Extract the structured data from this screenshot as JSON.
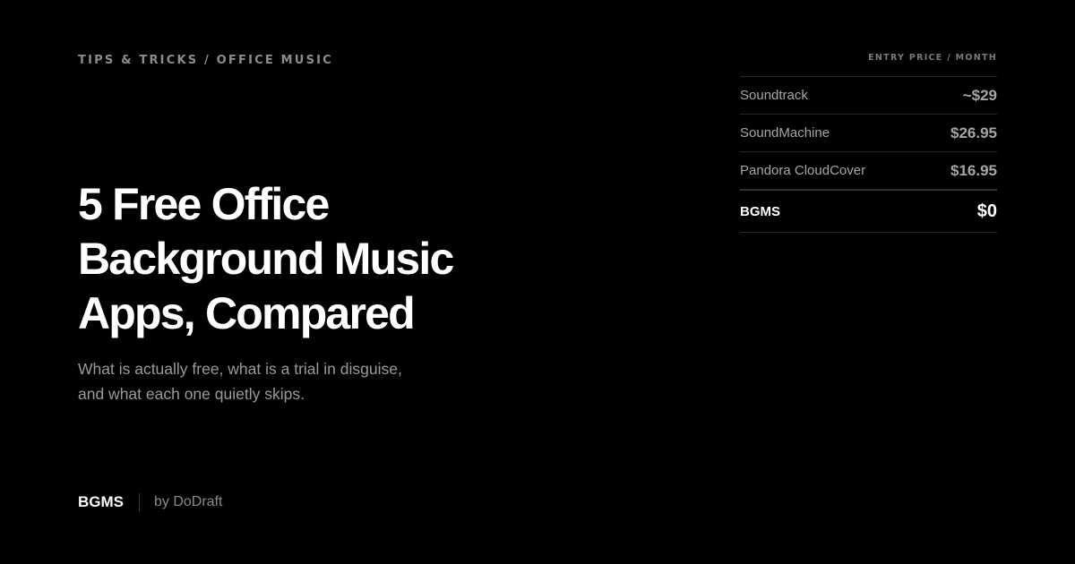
{
  "breadcrumb": "TIPS & TRICKS / OFFICE MUSIC",
  "title": {
    "line1": "5 Free Office",
    "line2": "Background Music",
    "line3": "Apps, Compared"
  },
  "subtitle": {
    "line1": "What is actually free, what is a trial in disguise,",
    "line2": "and what each one quietly skips."
  },
  "footer": {
    "brand": "BGMS",
    "byline": "by DoDraft"
  },
  "price_table": {
    "header": "ENTRY PRICE / MONTH",
    "rows": [
      {
        "name": "Soundtrack",
        "price": "~$29"
      },
      {
        "name": "SoundMachine",
        "price": "$26.95"
      },
      {
        "name": "Pandora CloudCover",
        "price": "$16.95"
      },
      {
        "name": "BGMS",
        "price": "$0"
      }
    ]
  },
  "colors": {
    "background": "#000000",
    "text_primary": "#ffffff",
    "text_muted": "#9a9a9a",
    "divider": "#262626"
  }
}
